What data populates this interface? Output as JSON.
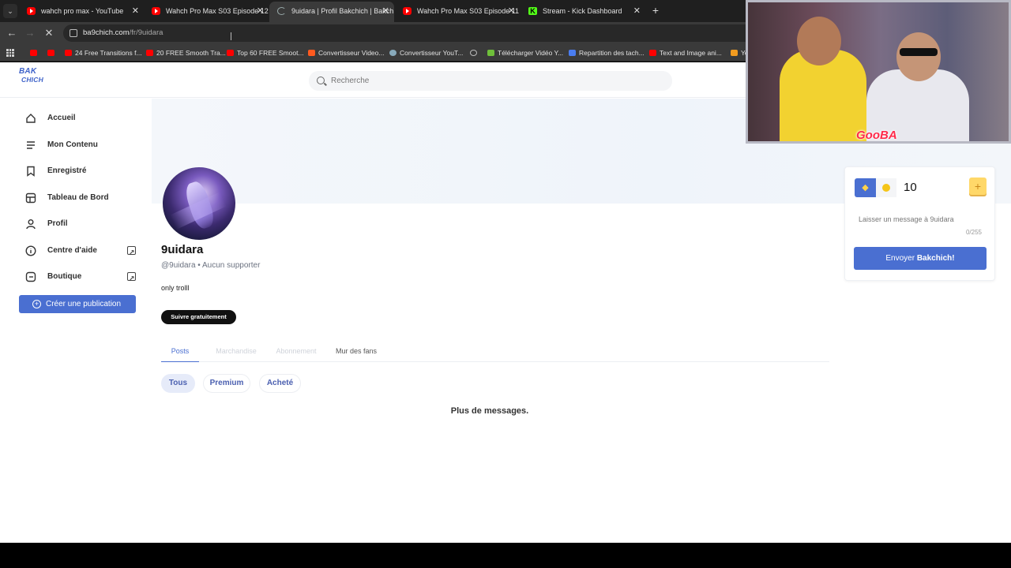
{
  "browser": {
    "tabs": [
      {
        "title": "wahch pro max - YouTube",
        "icon": "youtube-icon"
      },
      {
        "title": "Wahch Pro Max S03 Episode 12",
        "icon": "youtube-icon"
      },
      {
        "title": "9uidara | Profil Bakchich | Bakch",
        "icon": "loading-icon",
        "active": true
      },
      {
        "title": "Wahch Pro Max S03 Episode 11",
        "icon": "youtube-icon"
      },
      {
        "title": "Stream - Kick Dashboard",
        "icon": "kick-icon"
      }
    ],
    "new_tab": "+",
    "url_host": "ba9chich.com",
    "url_path": "/fr/9uidara",
    "bookmarks": [
      {
        "label": "",
        "icon": "youtube-icon"
      },
      {
        "label": "",
        "icon": "youtube-icon"
      },
      {
        "label": "24 Free Transitions f...",
        "icon": "youtube-icon"
      },
      {
        "label": "20 FREE Smooth Tra...",
        "icon": "youtube-icon"
      },
      {
        "label": "Top 60 FREE Smoot...",
        "icon": "youtube-icon"
      },
      {
        "label": "Convertisseur Video...",
        "icon": "z-icon"
      },
      {
        "label": "Convertisseur YouT...",
        "icon": "globe-icon"
      },
      {
        "label": "",
        "icon": "web-icon"
      },
      {
        "label": "Télécharger Vidéo Y...",
        "icon": "download-icon"
      },
      {
        "label": "Repartition des tach...",
        "icon": "docs-icon"
      },
      {
        "label": "Text and Image ani...",
        "icon": "youtube-icon"
      },
      {
        "label": "YouT",
        "icon": "orange-icon"
      }
    ]
  },
  "site": {
    "logo_line1": "BAK",
    "logo_line2": "CHICH",
    "search_placeholder": "Recherche"
  },
  "sidebar": {
    "items": [
      {
        "label": "Accueil",
        "icon": "home-icon"
      },
      {
        "label": "Mon Contenu",
        "icon": "menu-icon"
      },
      {
        "label": "Enregistré",
        "icon": "bookmark-icon"
      },
      {
        "label": "Tableau de Bord",
        "icon": "dashboard-icon"
      },
      {
        "label": "Profil",
        "icon": "user-icon"
      },
      {
        "label": "Centre d'aide",
        "icon": "info-icon",
        "external": true
      },
      {
        "label": "Boutique",
        "icon": "shop-icon",
        "external": true
      }
    ],
    "create_label": "Créer une publication"
  },
  "profile": {
    "name": "9uidara",
    "handle_line": "@9uidara • Aucun supporter",
    "bio": "only trolll",
    "follow_label": "Suivre gratuitement",
    "tabs": [
      "Posts",
      "Marchandise",
      "Abonnement",
      "Mur des fans"
    ],
    "filters": [
      "Tous",
      "Premium",
      "Acheté"
    ],
    "empty_message": "Plus de messages."
  },
  "tip": {
    "amount": "10",
    "plus": "+",
    "message_placeholder": "Laisser un message à 9uidara",
    "counter": "0/255",
    "send_prefix": "Envoyer ",
    "send_bold": "Bakchich!"
  },
  "webcam": {
    "overlay_tag": "GooBA"
  },
  "colors": {
    "accent": "#4a6fd1",
    "tab_bar": "#1f1f1f",
    "chrome": "#3a3a3a"
  }
}
